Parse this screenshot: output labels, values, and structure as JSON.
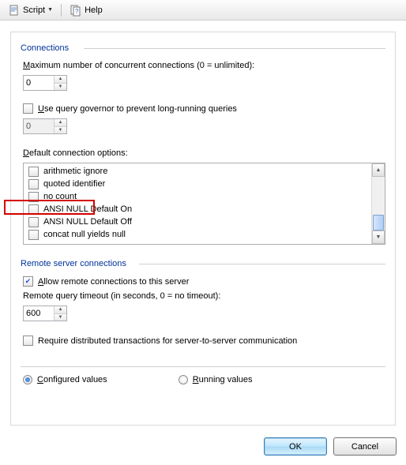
{
  "toolbar": {
    "script_label": "Script",
    "help_label": "Help"
  },
  "connections": {
    "section_title": "Connections",
    "max_conn_label_pre": "M",
    "max_conn_label_rest": "aximum number of concurrent connections (0 = unlimited):",
    "max_conn_value": "0",
    "query_gov_label_pre": "U",
    "query_gov_label_rest": "se query governor to prevent long-running queries",
    "query_gov_checked": false,
    "query_gov_value": "0",
    "default_opts_label_pre": "D",
    "default_opts_label_rest": "efault connection options:",
    "options": [
      {
        "label": "arithmetic ignore",
        "checked": false
      },
      {
        "label": "quoted identifier",
        "checked": false
      },
      {
        "label": "no count",
        "checked": false
      },
      {
        "label": "ANSI NULL Default On",
        "checked": false
      },
      {
        "label": "ANSI NULL Default Off",
        "checked": false
      },
      {
        "label": "concat null yields null",
        "checked": false
      }
    ]
  },
  "remote": {
    "section_title": "Remote server connections",
    "allow_label_pre": "A",
    "allow_label_rest": "llow remote connections to this server",
    "allow_checked": true,
    "timeout_label": "Remote query timeout (in seconds, 0 = no timeout):",
    "timeout_value": "600",
    "dist_label": "Require distributed transactions for server-to-server communication",
    "dist_checked": false
  },
  "radios": {
    "configured_pre": "C",
    "configured_rest": "onfigured values",
    "running_pre": "R",
    "running_rest": "unning values",
    "selected": "configured"
  },
  "buttons": {
    "ok": "OK",
    "cancel": "Cancel"
  }
}
